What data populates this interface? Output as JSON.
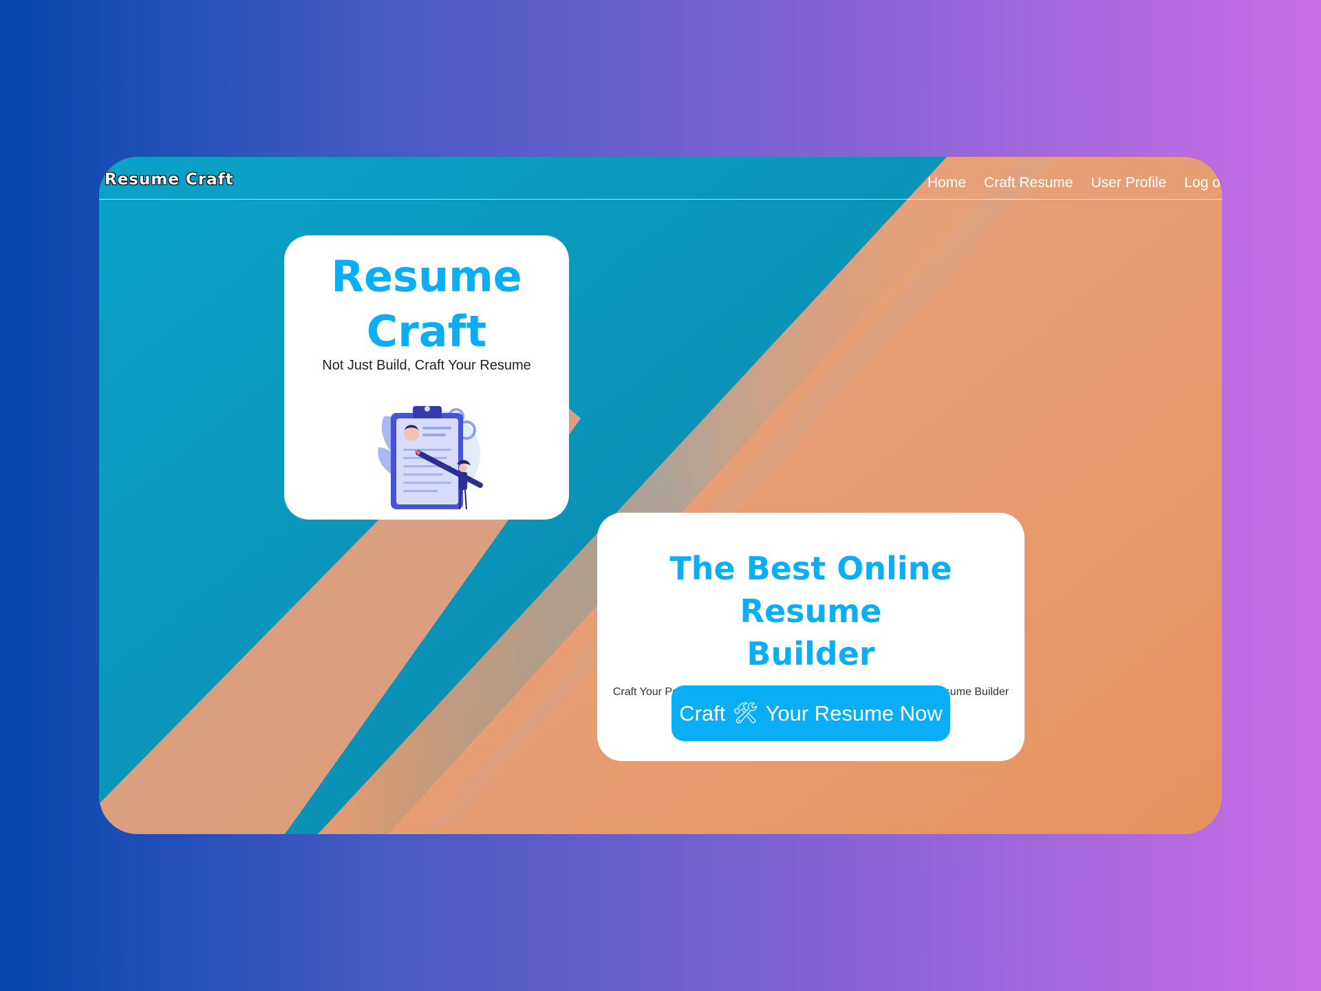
{
  "navbar": {
    "brand": "Resume Craft",
    "links": [
      "Home",
      "Craft Resume",
      "User Profile",
      "Log out"
    ]
  },
  "hero_card": {
    "title_line1": "Resume",
    "title_line2": "Craft",
    "tagline": "Not Just Build, Craft Your Resume",
    "illustration_icon": "resume-clipboard-illustration"
  },
  "promo_card": {
    "heading_line1": "The Best Online Resume",
    "heading_line2": "Builder",
    "description": "Craft Your Perfect Resume For Any Job Using Our Best-In-Class Resume Builder Platform",
    "cta_before": "Craft",
    "cta_icon": "🛠",
    "cta_after": "Your Resume Now"
  },
  "colors": {
    "accent": "#0aaef5",
    "teal": "#0097c3",
    "peach": "#e89c70"
  }
}
